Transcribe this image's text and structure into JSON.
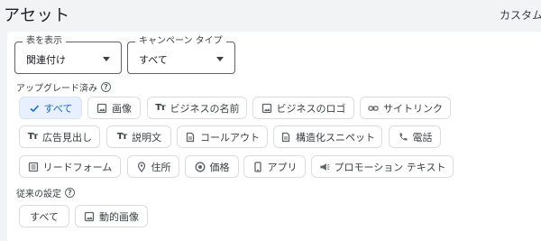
{
  "header": {
    "title": "アセット",
    "custom_link": "カスタム"
  },
  "filters": {
    "table_view": {
      "label": "表を表示",
      "value": "関連付け"
    },
    "campaign_type": {
      "label": "キャンペーン タイプ",
      "value": "すべて"
    }
  },
  "upgraded": {
    "label": "アップグレード済み",
    "chips": [
      {
        "label": "すべて",
        "icon": "check-icon",
        "selected": true
      },
      {
        "label": "画像",
        "icon": "image-icon"
      },
      {
        "label": "ビジネスの名前",
        "icon": "text-icon"
      },
      {
        "label": "ビジネスのロゴ",
        "icon": "image-icon"
      },
      {
        "label": "サイトリンク",
        "icon": "link-icon"
      },
      {
        "label": "広告見出し",
        "icon": "text-icon"
      },
      {
        "label": "説明文",
        "icon": "text-icon"
      },
      {
        "label": "コールアウト",
        "icon": "document-icon"
      },
      {
        "label": "構造化スニペット",
        "icon": "document-icon"
      },
      {
        "label": "電話",
        "icon": "phone-icon"
      },
      {
        "label": "リードフォーム",
        "icon": "form-icon"
      },
      {
        "label": "住所",
        "icon": "location-icon"
      },
      {
        "label": "価格",
        "icon": "price-icon"
      },
      {
        "label": "アプリ",
        "icon": "phone-app-icon"
      },
      {
        "label": "プロモーション テキスト",
        "icon": "megaphone-icon"
      }
    ]
  },
  "legacy": {
    "label": "従来の設定",
    "chips": [
      {
        "label": "すべて",
        "icon": ""
      },
      {
        "label": "動的画像",
        "icon": "image-icon"
      }
    ]
  }
}
